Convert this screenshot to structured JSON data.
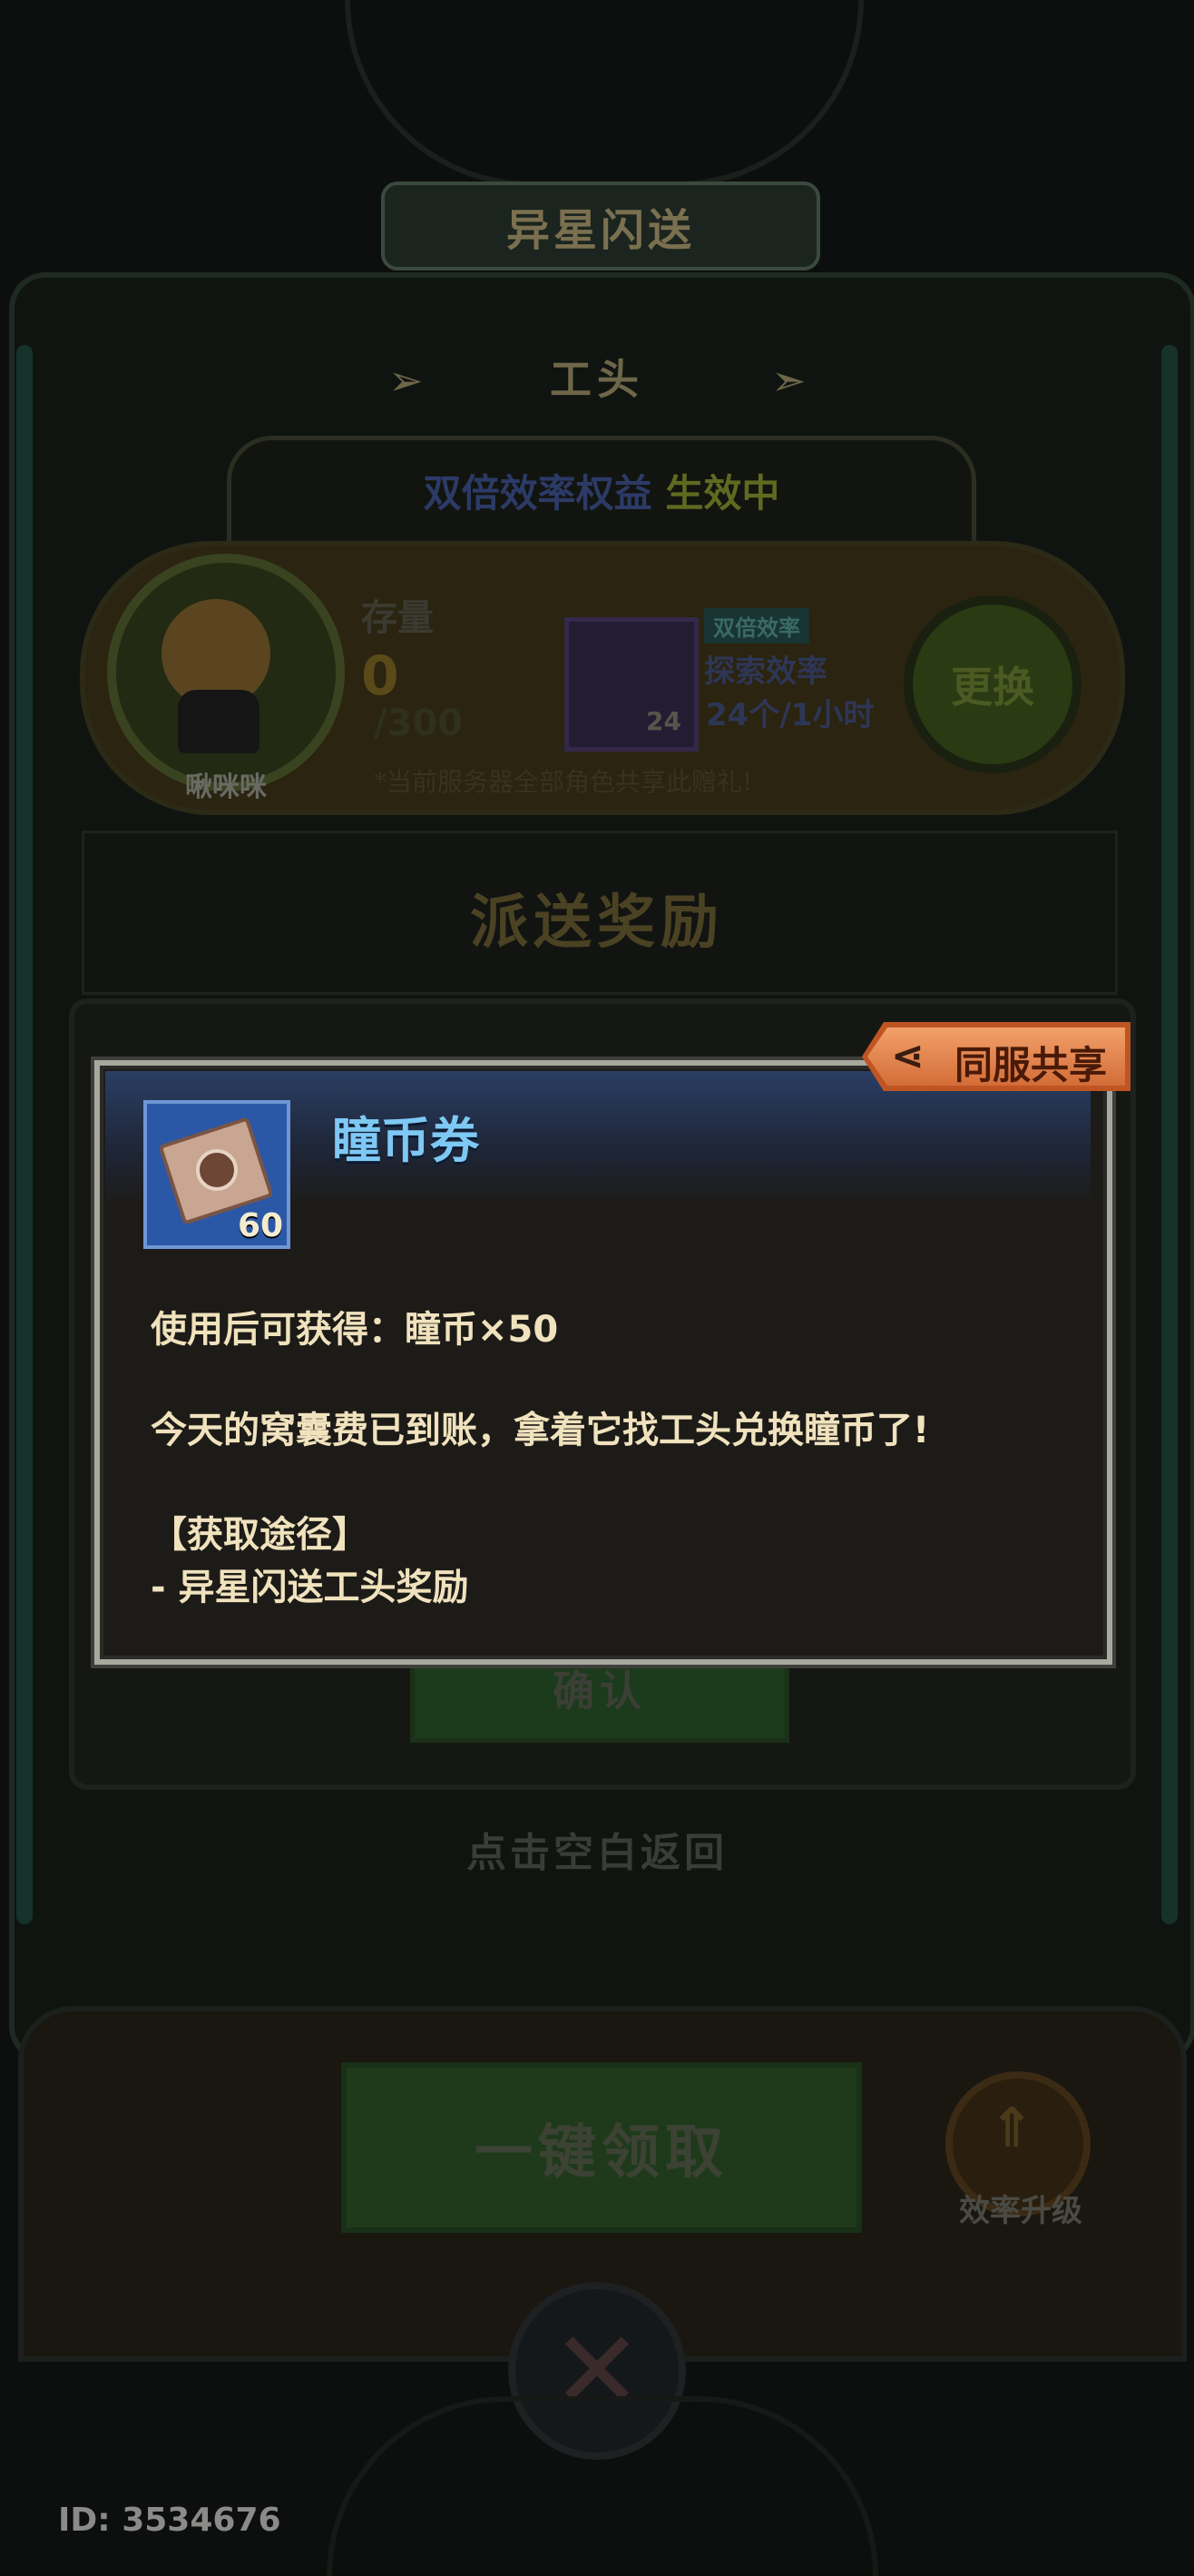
{
  "header": {
    "title": "异星闪送"
  },
  "section": {
    "title": "工头",
    "arrow_left": "➢",
    "arrow_right": "➣"
  },
  "status": {
    "label": "双倍效率权益",
    "state": "生效中"
  },
  "stock": {
    "label": "存量",
    "value": "0",
    "max": "/300"
  },
  "character": {
    "name": "啾咪咪"
  },
  "bonus": {
    "tag": "双倍效率",
    "name": "探索效率",
    "rate": "24个/1小时",
    "slot_count": "24"
  },
  "swap_button": "更换",
  "share_note": "*当前服务器全部角色共享此赠礼!",
  "reward": {
    "title": "派送奖励",
    "confirm_label": "确认"
  },
  "tap_return": "点击空白返回",
  "collect_all_button": "一键领取",
  "upgrade": {
    "label": "效率升级"
  },
  "user": {
    "id_label": "ID: 3534676"
  },
  "popup": {
    "share_tag": "同服共享",
    "item_name": "瞳币券",
    "item_count": "60",
    "desc_use": "使用后可获得：瞳币×50",
    "desc_flavor": "今天的窝囊费已到账，拿着它找工头兑换瞳币了!",
    "source_heading": "【获取途径】",
    "source_item": "- 异星闪送工头奖励"
  },
  "colors": {
    "title_blue": "#7ec8f4",
    "desc_text": "#f0e2bd",
    "share_orange": "#d36d38",
    "icon_box_blue": "#2b58a6"
  },
  "icons": {
    "share": "share-icon",
    "close": "close-icon",
    "upgrade": "upgrade-arrow-icon",
    "item": "ticket-icon"
  }
}
